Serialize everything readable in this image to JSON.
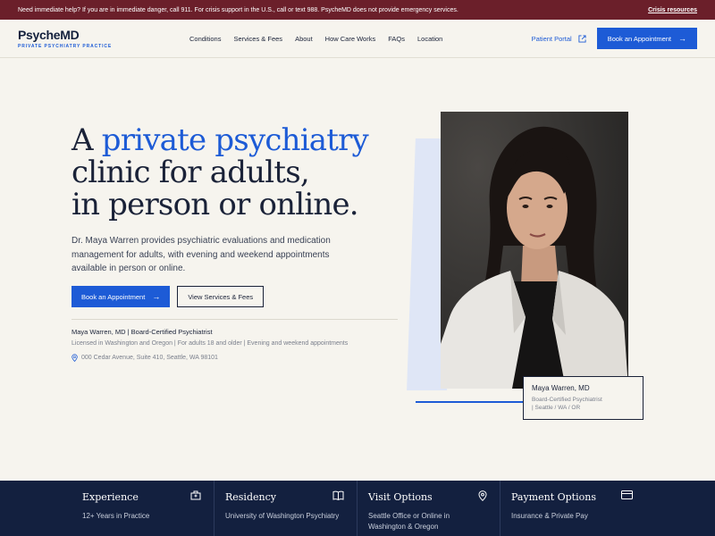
{
  "alert": {
    "message": "Need immediate help? If you are in immediate danger, call 911. For crisis support in the U.S., call or text 988. PsycheMD does not provide emergency services.",
    "link": "Crisis resources"
  },
  "brand": {
    "name": "PsycheMD",
    "tagline": "PRIVATE PSYCHIATRY PRACTICE"
  },
  "nav": [
    "Conditions",
    "Services & Fees",
    "About",
    "How Care Works",
    "FAQs",
    "Location"
  ],
  "header": {
    "portal_label": "Patient Portal",
    "book_label": "Book an Appointment"
  },
  "hero": {
    "headline_prefix": "A ",
    "headline_accent": "private psychiatry",
    "headline_line2": "clinic for adults,",
    "headline_line3": "in person or online.",
    "lead": "Dr. Maya Warren provides psychiatric evaluations and medication management for adults, with evening and weekend appointments available in person or online.",
    "primary_cta": "Book an Appointment",
    "secondary_cta": "View Services & Fees",
    "doctor_line": "Maya Warren, MD | Board-Certified Psychiatrist",
    "license_line": "Licensed in Washington and Oregon | For adults 18 and older | Evening and weekend appointments",
    "address": "000 Cedar Avenue, Suite 410, Seattle, WA 98101"
  },
  "caption": {
    "name": "Maya Warren, MD",
    "role": "Board-Certified Psychiatrist",
    "locations": "| Seattle / WA / OR"
  },
  "facts": [
    {
      "title": "Experience",
      "text": "12+ Years in Practice",
      "icon": "hospital-icon"
    },
    {
      "title": "Residency",
      "text": "University of Washington Psychiatry",
      "icon": "book-icon"
    },
    {
      "title": "Visit Options",
      "text": "Seattle Office or Online in Washington & Oregon",
      "icon": "map-pin-icon"
    },
    {
      "title": "Payment Options",
      "text": "Insurance & Private Pay",
      "icon": "credit-card-icon"
    }
  ],
  "colors": {
    "accent": "#1d5bd6",
    "alert_bg": "#6b1f2a",
    "footer_bg": "#13203f",
    "page_bg": "#f6f4ee"
  }
}
